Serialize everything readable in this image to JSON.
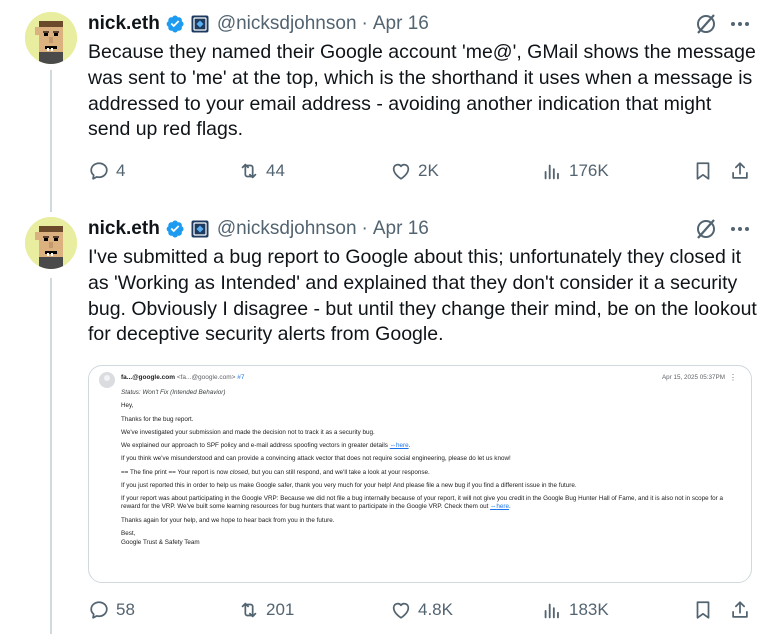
{
  "tweets": [
    {
      "author": {
        "name": "nick.eth",
        "handle": "@nicksdjohnson",
        "separator": "·",
        "date": "Apr 16"
      },
      "text": "Because they named their Google account 'me@', GMail shows the message was sent to 'me' at the top, which is the shorthand it uses when a message is addressed to your email address - avoiding another indication that might send up red flags.",
      "stats": {
        "replies": "4",
        "reposts": "44",
        "likes": "2K",
        "views": "176K"
      }
    },
    {
      "author": {
        "name": "nick.eth",
        "handle": "@nicksdjohnson",
        "separator": "·",
        "date": "Apr 16"
      },
      "text": "I've submitted a bug report to Google about this; unfortunately they closed it as 'Working as Intended' and explained that they don't consider it a security bug. Obviously I disagree - but until they change their mind, be on the lookout for deceptive security alerts from Google.",
      "stats": {
        "replies": "58",
        "reposts": "201",
        "likes": "4.8K",
        "views": "183K"
      }
    }
  ],
  "email": {
    "sender": "fa...@google.com",
    "sender_address": "<fa...@google.com>",
    "issue_ref": "#7",
    "date": "Apr 15, 2025 05:37PM",
    "status": "Status: Won't Fix (Intended Behavior)",
    "greeting": "Hey,",
    "p1": "Thanks for the bug report.",
    "p2": "We've investigated your submission and made the decision not to track it as a security bug.",
    "p3": "We explained our approach to SPF policy and e-mail address spoofing vectors in greater details",
    "p3_link": "here",
    "p4": "If you think we've misunderstood and can provide a convincing attack vector that does not require social engineering, please do let us know!",
    "p5_a": "== The fine print == Your report is now",
    "p5_em": "closed",
    "p5_b": ", but you can still respond, and we'll take a look at your response.",
    "p6": "If you just reported this in order to help us make Google safer, thank you very much for your help! And please file a new bug if you find a different issue in the future.",
    "p7": "If your report was about participating in the Google VRP: Because we did not file a bug internally because of your report, it will not give you credit in the Google Bug Hunter Hall of Fame, and it is also not in scope for a reward for the VRP. We've built some learning resources for bug hunters that want to participate in the Google VRP. Check them out",
    "p7_link": "here",
    "p8": "Thanks again for your help, and we hope to hear back from you in the future.",
    "closing": "Best,",
    "signature": "Google Trust & Safety Team"
  },
  "colors": {
    "accent_blue": "#1d9bf0",
    "muted": "#536471",
    "text": "#0f1419",
    "avatar_bg": "#e8eda0"
  },
  "icons": [
    "verified-badge-icon",
    "affiliate-badge-icon",
    "grok-icon",
    "more-icon",
    "reply-icon",
    "repost-icon",
    "like-icon",
    "views-icon",
    "bookmark-icon",
    "share-icon"
  ]
}
